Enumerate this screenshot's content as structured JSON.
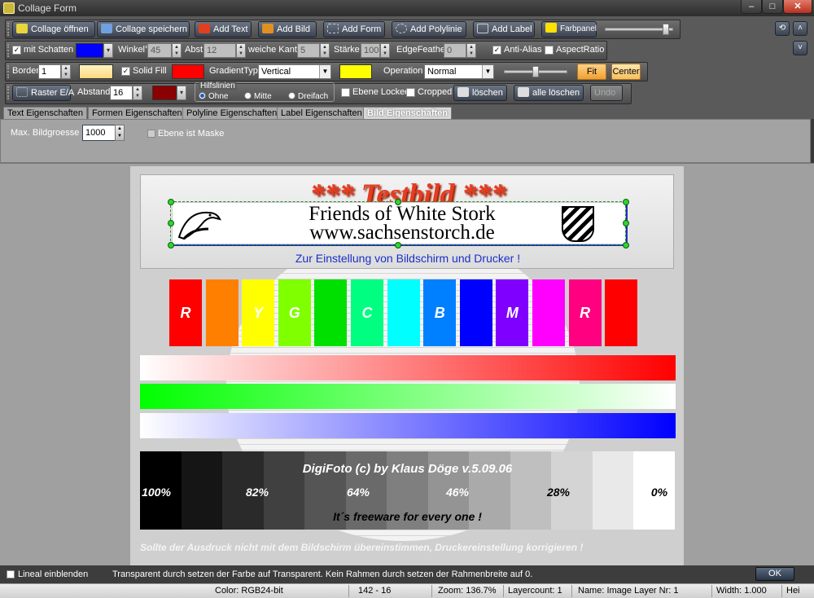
{
  "window": {
    "title": "Collage Form",
    "min_label": "‒",
    "max_label": "□",
    "close_label": "✕"
  },
  "toolbar1": {
    "open_label": "Collage öffnen",
    "save_label": "Collage speichern",
    "add_text_label": "Add Text",
    "add_image_label": "Add Bild",
    "add_form_label": "Add Form",
    "add_polyline_label": "Add Polylinie",
    "add_label_label": "Add Label",
    "farbpanel_label": "Farbpanel"
  },
  "toolbar2": {
    "shadow_label": "mit Schatten",
    "angle_label": "Winkel°",
    "angle_value": "45",
    "distance_label": "Abst",
    "distance_value": "12",
    "soft_edge_label": "weiche Kante",
    "soft_edge_value": "5",
    "strength_label": "Stärke",
    "strength_value": "100",
    "edge_feather_label": "EdgeFeather",
    "edge_feather_value": "0",
    "antialias_label": "Anti-Alias",
    "aspect_label": "AspectRatio"
  },
  "toolbar3": {
    "border_label": "Border",
    "border_value": "1",
    "solid_fill_label": "Solid Fill",
    "gradient_type_label": "GradientTyp",
    "gradient_type_value": "Vertical",
    "operation_label": "Operation",
    "operation_value": "Normal",
    "fit_label": "Fit",
    "center_label": "Center"
  },
  "toolbar4": {
    "raster_label": "Raster E/A",
    "spacing_label": "Abstand",
    "spacing_value": "16",
    "guides_label": "Hilfslinien",
    "guide_none": "Ohne",
    "guide_middle": "Mitte",
    "guide_triple": "Dreifach",
    "layer_locked_label": "Ebene Locked",
    "cropped_label": "Cropped",
    "delete_label": "löschen",
    "delete_all_label": "alle löschen",
    "undo_label": "Undo"
  },
  "tabs": [
    "Text Eigenschaften",
    "Formen Eigenschaften",
    "Polyline Eigenschaften",
    "Label Eigenschaften",
    "Bild Eigenschaften"
  ],
  "panel": {
    "max_size_label": "Max. Bildgroesse",
    "max_size_value": "1000",
    "mask_label": "Ebene ist Maske"
  },
  "canvas": {
    "testbild_text": "*** Testbild ***",
    "logo_line1": "Friends of White Stork",
    "logo_line2": "www.sachsenstorch.de",
    "subtitle": "Zur Einstellung von Bildschirm und Drucker !",
    "swatch_letters": [
      "R",
      "",
      "Y",
      "G",
      "",
      "C",
      "",
      "B",
      "",
      "M",
      "",
      "R"
    ],
    "digifoto_text": "DigiFoto (c) by Klaus Döge v.5.09.06",
    "percent_labels": [
      "100%",
      "82%",
      "64%",
      "46%",
      "28%",
      "0%"
    ],
    "freeware_text": "It´s freeware for every one !",
    "footer_note": "Sollte der Ausdruck nicht mit dem Bildschirm übereinstimmen, Druckereinstellung korrigieren !"
  },
  "colors": {
    "swatches": [
      "#ff0000",
      "#ff8000",
      "#ffff00",
      "#80ff00",
      "#00e000",
      "#00ff80",
      "#00ffff",
      "#0080ff",
      "#0000ff",
      "#8000ff",
      "#ff00ff",
      "#ff0080",
      "#ff0000"
    ],
    "grays": [
      "#000000",
      "#151515",
      "#2a2a2a",
      "#404040",
      "#555555",
      "#6a6a6a",
      "#7f7f7f",
      "#949494",
      "#aaaaaa",
      "#bfbfbf",
      "#d4d4d4",
      "#e9e9e9",
      "#ffffff"
    ]
  },
  "bottom": {
    "ruler_label": "Lineal einblenden",
    "hint": "Transparent durch setzen der Farbe auf Transparent. Kein Rahmen durch setzen der Rahmenbreite auf  0.",
    "ok_label": "OK"
  },
  "status": {
    "color": "Color: RGB24-bit",
    "coords": "142 - 16",
    "zoom": "Zoom: 136.7%",
    "layercount": "Layercount: 1",
    "name": "Name: Image Layer Nr: 1",
    "width": "Width: 1.000",
    "height": "Hei"
  }
}
